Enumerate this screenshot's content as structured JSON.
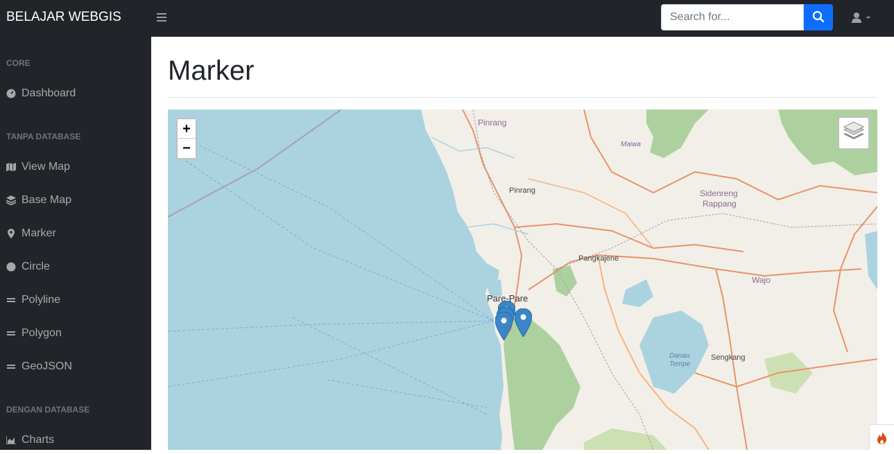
{
  "header": {
    "brand": "BELAJAR WEBGIS",
    "search_placeholder": "Search for..."
  },
  "sidebar": {
    "sections": [
      {
        "heading": "CORE",
        "items": [
          {
            "label": "Dashboard",
            "icon": "tachometer-icon"
          }
        ]
      },
      {
        "heading": "TANPA DATABASE",
        "items": [
          {
            "label": "View Map",
            "icon": "map-icon"
          },
          {
            "label": "Base Map",
            "icon": "layer-group-icon"
          },
          {
            "label": "Marker",
            "icon": "map-marker-icon"
          },
          {
            "label": "Circle",
            "icon": "circle-icon"
          },
          {
            "label": "Polyline",
            "icon": "grip-lines-icon"
          },
          {
            "label": "Polygon",
            "icon": "grip-lines-icon"
          },
          {
            "label": "GeoJSON",
            "icon": "grip-lines-icon"
          }
        ]
      },
      {
        "heading": "DENGAN DATABASE",
        "items": [
          {
            "label": "Charts",
            "icon": "chart-area-icon"
          }
        ]
      }
    ]
  },
  "page": {
    "title": "Marker"
  },
  "map": {
    "zoom_in": "+",
    "zoom_out": "−",
    "places": [
      "Pinrang",
      "Pinrang",
      "Maiwa",
      "Sidenreng",
      "Rappang",
      "Pangkajene",
      "Wajo",
      "Pare-Pare",
      "Danau",
      "Tempe",
      "Sengkang"
    ],
    "marker_count": 4,
    "marker_color": "#3a86c8"
  }
}
